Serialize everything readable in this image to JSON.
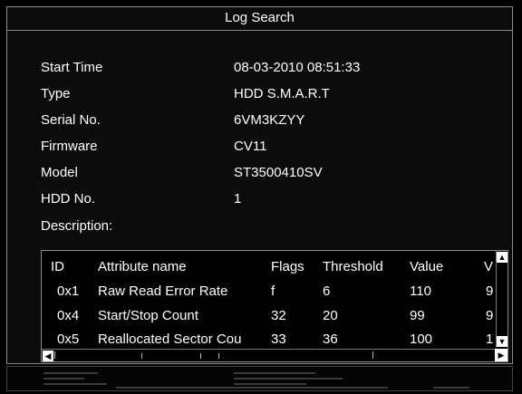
{
  "window": {
    "title": "Log Search"
  },
  "fields": [
    {
      "label": "Start Time",
      "value": "08-03-2010 08:51:33"
    },
    {
      "label": "Type",
      "value": "HDD S.M.A.R.T"
    },
    {
      "label": "Serial No.",
      "value": "6VM3KZYY"
    },
    {
      "label": "Firmware",
      "value": "CV11"
    },
    {
      "label": "Model",
      "value": "ST3500410SV"
    },
    {
      "label": "HDD No.",
      "value": "1"
    }
  ],
  "description_label": "Description:",
  "table": {
    "headers": [
      "ID",
      "Attribute name",
      "Flags",
      "Threshold",
      "Value",
      "V"
    ],
    "rows": [
      [
        "0x1",
        "Raw Read Error Rate",
        "f",
        "6",
        "110",
        "9"
      ],
      [
        "0x4",
        "Start/Stop Count",
        "32",
        "20",
        "99",
        "9"
      ],
      [
        "0x5",
        "Reallocated Sector Cou",
        "33",
        "36",
        "100",
        "1"
      ]
    ]
  },
  "icons": {
    "scroll_up": "▲",
    "scroll_down": "▼",
    "scroll_left": "◀",
    "scroll_right": "▶"
  }
}
